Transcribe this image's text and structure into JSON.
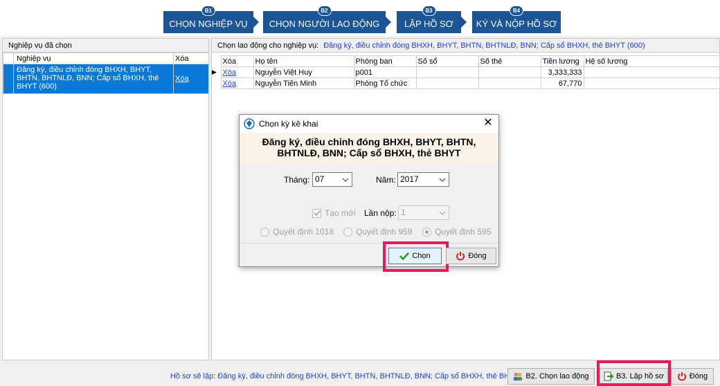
{
  "steps": [
    {
      "badge": "B1",
      "label": "CHỌN NGHIỆP VỤ"
    },
    {
      "badge": "B2",
      "label": "CHỌN NGƯỜI LAO ĐỘNG"
    },
    {
      "badge": "B3",
      "label": "LẬP HỒ SƠ"
    },
    {
      "badge": "B4",
      "label": "KÝ VÀ NỘP HỒ SƠ"
    }
  ],
  "left_panel": {
    "header": "Nghiệp vụ đã chọn",
    "columns": [
      "Nghiệp vụ",
      "Xóa"
    ],
    "rows": [
      {
        "name": "Đăng ký, điều chỉnh đóng BHXH, BHYT, BHTN, BHTNLĐ, BNN; Cấp sổ BHXH, thẻ BHYT (600)",
        "delete": "Xóa"
      }
    ]
  },
  "right_panel": {
    "header_label": "Chọn lao động cho nghiệp vụ:",
    "header_value": "Đăng ký, điều chỉnh đóng BHXH, BHYT, BHTN, BHTNLĐ, BNN; Cấp sổ BHXH, thẻ BHYT (600)",
    "columns": [
      "Xóa",
      "Họ tên",
      "Phòng ban",
      "Số sổ",
      "Số thẻ",
      "Tiền lương",
      "Hệ số lương"
    ],
    "rows": [
      {
        "delete": "Xóa",
        "name": "Nguyễn Việt Huy",
        "dept": "p001",
        "book": "",
        "card": "",
        "salary": "3,333,333",
        "coef": ""
      },
      {
        "delete": "Xóa",
        "name": "Nguyễn Tiến Minh",
        "dept": "Phòng Tổ chức",
        "book": "",
        "card": "",
        "salary": "67,770",
        "coef": ""
      }
    ]
  },
  "dialog": {
    "title": "Chọn kỳ kê khai",
    "heading": "Đăng ký, điều chỉnh đóng BHXH, BHYT, BHTN, BHTNLĐ, BNN; Cấp sổ BHXH, thẻ BHYT",
    "month_label": "Tháng:",
    "month_value": "07",
    "year_label": "Năm:",
    "year_value": "2017",
    "new_label": "Tạo mới",
    "submission_label": "Lần nộp:",
    "submission_value": "1",
    "radios": [
      "Quyết định 1018",
      "Quyết định 959",
      "Quyết định 595"
    ],
    "choose_button": "Chọn",
    "close_button": "Đóng"
  },
  "bottom": {
    "summary": "Hồ sơ sẽ lập: Đăng ký, điều chỉnh đóng BHXH, BHYT, BHTN, BHTNLĐ, BNN; Cấp sổ BHXH, thẻ BHYT",
    "step2_button": "B2. Chọn lao động",
    "step3_button": "B3. Lập hồ sơ",
    "close_button": "Đóng"
  },
  "colors": {
    "step_blue": "#1c5596",
    "highlight": "#e8195f",
    "link": "#1f3fd6",
    "selection": "#0a78d7"
  }
}
